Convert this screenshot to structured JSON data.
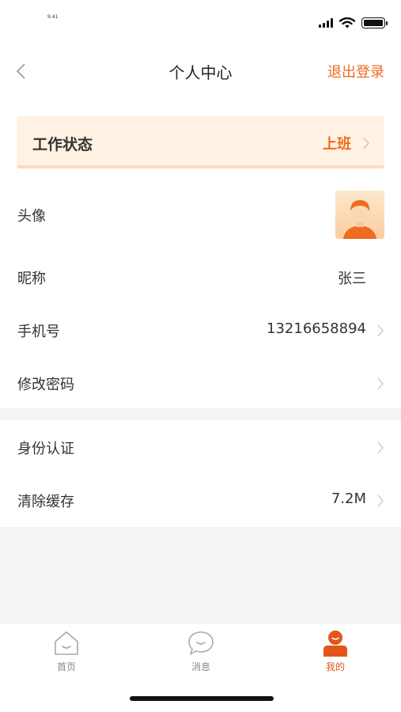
{
  "status_bar": {
    "time": "9:41"
  },
  "nav": {
    "title": "个人中心",
    "logout_label": "退出登录"
  },
  "work_status": {
    "label": "工作状态",
    "value": "上班"
  },
  "profile": {
    "avatar_label": "头像",
    "nickname_label": "昵称",
    "nickname_value": "张三",
    "phone_label": "手机号",
    "phone_value": "13216658894",
    "password_label": "修改密码"
  },
  "settings": {
    "identity_label": "身份认证",
    "cache_label": "清除缓存",
    "cache_value": "7.2M"
  },
  "tabs": [
    {
      "label": "首页",
      "icon": "home-icon"
    },
    {
      "label": "消息",
      "icon": "message-icon"
    },
    {
      "label": "我的",
      "icon": "profile-icon"
    }
  ],
  "colors": {
    "accent": "#ee6b1f",
    "work_card_bg": "#fff2e2",
    "divider_bg": "#f4f4f4"
  }
}
